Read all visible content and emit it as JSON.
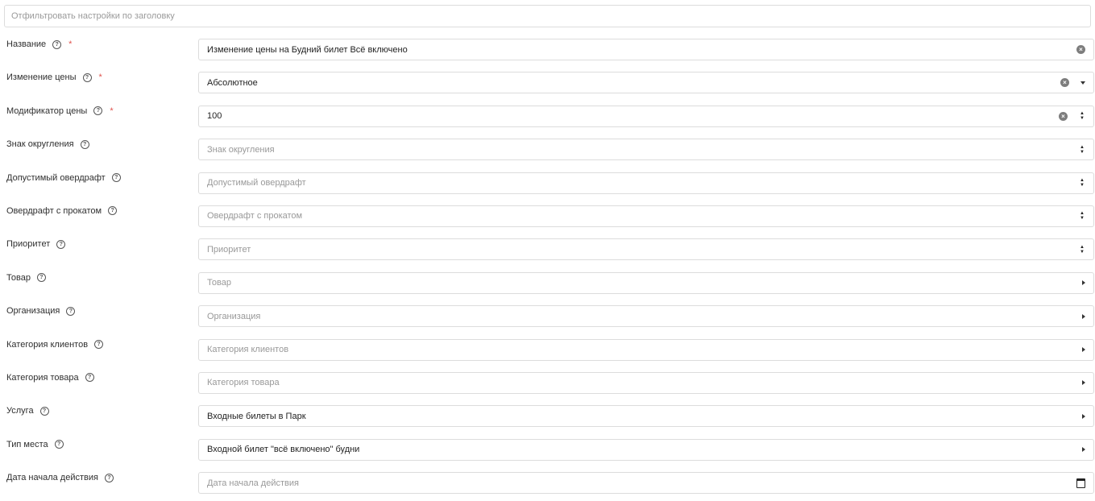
{
  "filter": {
    "placeholder": "Отфильтровать настройки по заголовку"
  },
  "fields": [
    {
      "label": "Название",
      "required": true,
      "value": "Изменение цены на Будний билет Всё включено",
      "placeholder": "",
      "controls": [
        "clear"
      ]
    },
    {
      "label": "Изменение цены",
      "required": true,
      "value": "Абсолютное",
      "placeholder": "",
      "controls": [
        "clear",
        "dropdown"
      ]
    },
    {
      "label": "Модификатор цены",
      "required": true,
      "value": "100",
      "placeholder": "",
      "controls": [
        "clear",
        "stepper"
      ]
    },
    {
      "label": "Знак округления",
      "required": false,
      "value": "",
      "placeholder": "Знак округления",
      "controls": [
        "stepper"
      ]
    },
    {
      "label": "Допустимый овердрафт",
      "required": false,
      "value": "",
      "placeholder": "Допустимый овердрафт",
      "controls": [
        "stepper"
      ]
    },
    {
      "label": "Овердрафт с прокатом",
      "required": false,
      "value": "",
      "placeholder": "Овердрафт с прокатом",
      "controls": [
        "stepper"
      ]
    },
    {
      "label": "Приоритет",
      "required": false,
      "value": "",
      "placeholder": "Приоритет",
      "controls": [
        "stepper"
      ]
    },
    {
      "label": "Товар",
      "required": false,
      "value": "",
      "placeholder": "Товар",
      "controls": [
        "arrow"
      ]
    },
    {
      "label": "Организация",
      "required": false,
      "value": "",
      "placeholder": "Организация",
      "controls": [
        "arrow"
      ]
    },
    {
      "label": "Категория клиентов",
      "required": false,
      "value": "",
      "placeholder": "Категория клиентов",
      "controls": [
        "arrow"
      ]
    },
    {
      "label": "Категория товара",
      "required": false,
      "value": "",
      "placeholder": "Категория товара",
      "controls": [
        "arrow"
      ]
    },
    {
      "label": "Услуга",
      "required": false,
      "value": "Входные билеты в Парк",
      "placeholder": "",
      "controls": [
        "arrow"
      ]
    },
    {
      "label": "Тип места",
      "required": false,
      "value": "Входной билет \"всё включено\" будни",
      "placeholder": "",
      "controls": [
        "arrow"
      ]
    },
    {
      "label": "Дата начала действия",
      "required": false,
      "value": "",
      "placeholder": "Дата начала действия",
      "controls": [
        "calendar"
      ]
    }
  ],
  "symbols": {
    "help": "?",
    "required": "*",
    "clear": "×",
    "step_up": "▲",
    "step_down": "▼"
  },
  "icons": {
    "help": "help-circle-icon",
    "clear": "clear-circle-icon",
    "dropdown": "chevron-down-icon",
    "arrow": "chevron-right-icon",
    "stepper": "number-stepper-icon",
    "calendar": "calendar-icon"
  },
  "colors": {
    "required": "#e0534e",
    "border": "#dcdcdc",
    "placeholder": "#999999"
  }
}
